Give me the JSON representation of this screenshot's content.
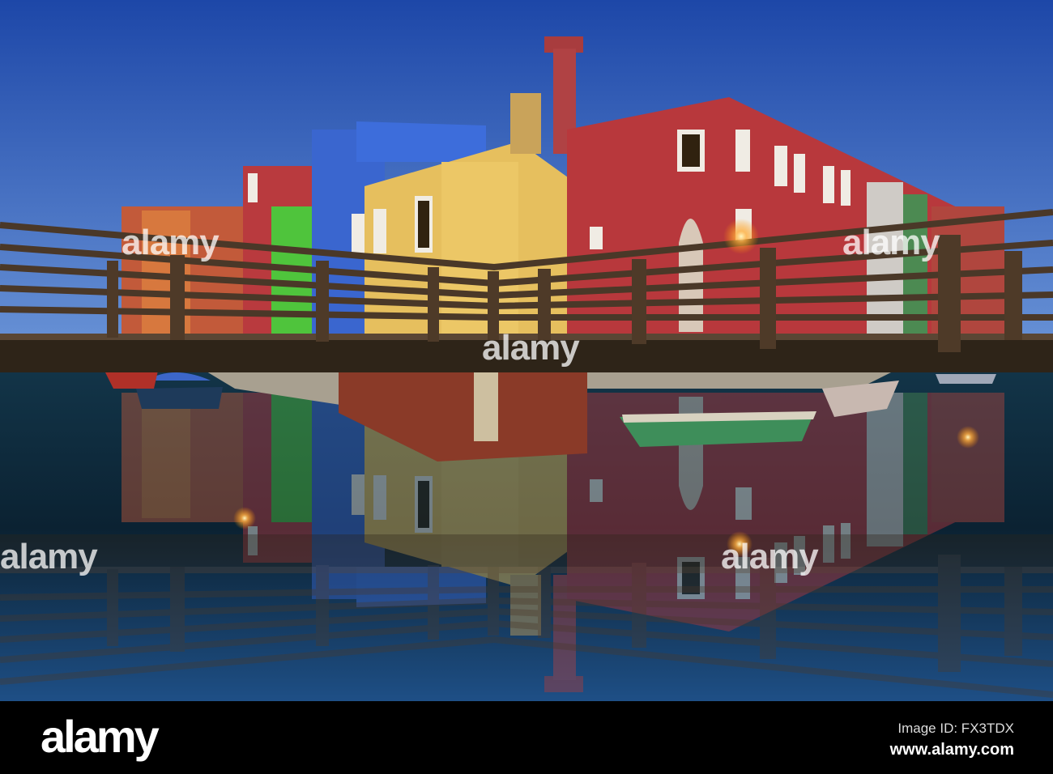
{
  "photo": {
    "subject": "Colorful houses of Burano by a canal at dusk with wooden footbridge",
    "colors": {
      "sky_top": "#1d47a8",
      "sky_horizon": "#6b95d8",
      "water_dark": "#0b2232",
      "water_light": "#1e4f86",
      "red_house": "#b8383c",
      "yellow_house": "#e6bf5e",
      "blue_house": "#3a66cf",
      "green_house": "#4fc43c",
      "bridge_wood": "#3b2a1c"
    }
  },
  "watermark": {
    "text": "alamy",
    "alt_text": "a"
  },
  "footer": {
    "logo": "alamy",
    "image_id": "Image ID: FX3TDX",
    "url": "www.alamy.com"
  }
}
